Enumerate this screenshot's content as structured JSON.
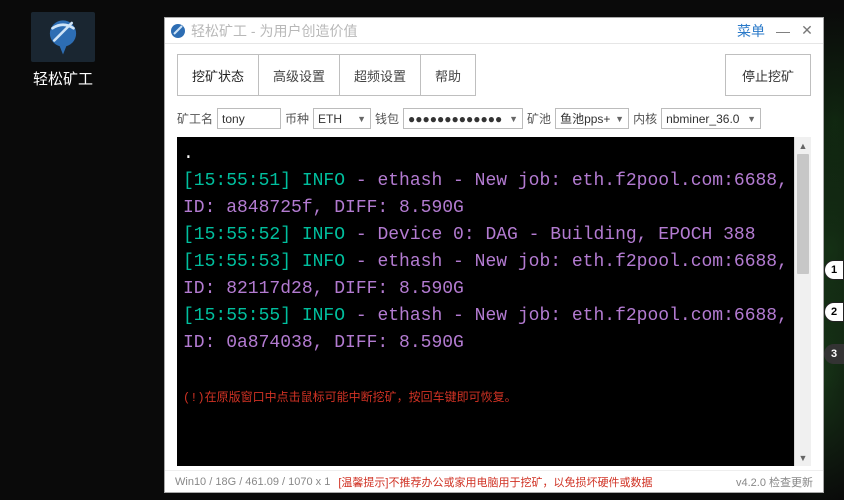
{
  "desktop_icon": {
    "label": "轻松矿工"
  },
  "window": {
    "title": "轻松矿工 - 为用户创造价值",
    "menu_label": "菜单"
  },
  "tabs": {
    "mining_status": "挖矿状态",
    "advanced": "高级设置",
    "overclock": "超频设置",
    "help": "帮助"
  },
  "actions": {
    "stop": "停止挖矿"
  },
  "fields": {
    "miner_name_label": "矿工名",
    "miner_name_value": "tony",
    "coin_label": "币种",
    "coin_value": "ETH",
    "wallet_label": "钱包",
    "wallet_value": "●●●●●●●●●●●●●",
    "pool_label": "矿池",
    "pool_value": "鱼池pps+",
    "core_label": "内核",
    "core_value": "nbminer_36.0"
  },
  "terminal": {
    "lines": [
      {
        "ts": "[15:55:51]",
        "lvl": "INFO",
        "dash": " - ",
        "seg1": "ethash",
        "seg2": " - New job: eth.f2pool.com:6688, ID: a848725f, DIFF: 8.590G"
      },
      {
        "ts": "[15:55:52]",
        "lvl": "INFO",
        "dash": " - ",
        "seg1": "Device 0: DAG - Building, EPOCH 388",
        "seg2": ""
      },
      {
        "ts": "[15:55:53]",
        "lvl": "INFO",
        "dash": " - ",
        "seg1": "ethash",
        "seg2": " - New job: eth.f2pool.com:6688, ID: 82117d28, DIFF: 8.590G"
      },
      {
        "ts": "[15:55:55]",
        "lvl": "INFO",
        "dash": " - ",
        "seg1": "ethash",
        "seg2": " - New job: eth.f2pool.com:6688, ID: 0a874038, DIFF: 8.590G"
      }
    ],
    "warning": "(!)在原版窗口中点击鼠标可能中断挖矿，按回车键即可恢复。"
  },
  "statusbar": {
    "sys": "Win10  /  18G / 461.09  / 1070 x 1",
    "tip": "[温馨提示]不推荐办公或家用电脑用于挖矿，以免损坏硬件或数据",
    "version": "v4.2.0 检查更新"
  },
  "side_pills": [
    "1",
    "2",
    "3"
  ]
}
